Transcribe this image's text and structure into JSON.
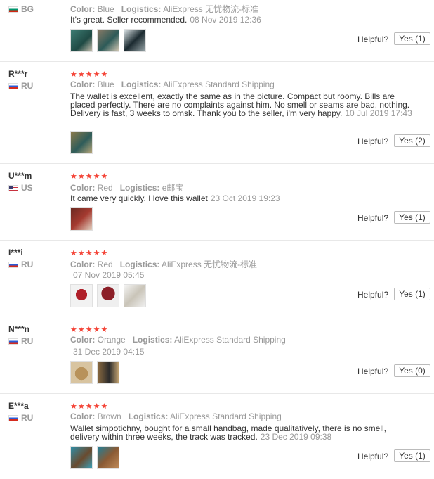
{
  "labels": {
    "color": "Color:",
    "logistics": "Logistics:",
    "helpful": "Helpful?"
  },
  "reviews": [
    {
      "user": "",
      "country": "BG",
      "flag": "bg",
      "stars": "",
      "color": "Blue",
      "logistics": "AliExpress 无忧物流-标准",
      "text": "It's great. Seller recommended.",
      "date": "08 Nov 2019 12:36",
      "images": [
        "wallet-photo",
        "wallet-photo",
        "wallet-photo"
      ],
      "helpful": "Yes (1)"
    },
    {
      "user": "R***r",
      "country": "RU",
      "flag": "ru",
      "stars": "★★★★★",
      "color": "Blue",
      "logistics": "AliExpress Standard Shipping",
      "text": "The wallet is excellent, exactly the same as in the picture. Compact but roomy. Bills are placed perfectly. There are no complaints against him. No smell or seams are bad, nothing. Delivery is fast, 3 weeks to omsk. Thank you to the seller, i'm very happy.",
      "date": "10 Jul 2019 17:43",
      "images": [
        "wallet-photo"
      ],
      "helpful": "Yes (2)"
    },
    {
      "user": "U***m",
      "country": "US",
      "flag": "us",
      "stars": "★★★★★",
      "color": "Red",
      "logistics": "e邮宝",
      "text": "It came very quickly. I love this wallet",
      "date": "23 Oct 2019 19:23",
      "images": [
        "wallet-photo"
      ],
      "helpful": "Yes (1)"
    },
    {
      "user": "I***i",
      "country": "RU",
      "flag": "ru",
      "stars": "★★★★★",
      "color": "Red",
      "logistics": "AliExpress 无忧物流-标准",
      "text": "",
      "date": "07 Nov 2019 05:45",
      "images": [
        "wallet-photo",
        "wallet-photo",
        "wallet-photo"
      ],
      "helpful": "Yes (1)"
    },
    {
      "user": "N***n",
      "country": "RU",
      "flag": "ru",
      "stars": "★★★★★",
      "color": "Orange",
      "logistics": "AliExpress Standard Shipping",
      "text": "",
      "date": "31 Dec 2019 04:15",
      "images": [
        "wallet-photo",
        "wallet-photo"
      ],
      "helpful": "Yes (0)"
    },
    {
      "user": "E***a",
      "country": "RU",
      "flag": "ru",
      "stars": "★★★★★",
      "color": "Brown",
      "logistics": "AliExpress Standard Shipping",
      "text": "Wallet simpotichny, bought for a small handbag, made qualitatively, there is no smell, delivery within three weeks, the track was tracked.",
      "date": "23 Dec 2019 09:38",
      "images": [
        "wallet-photo",
        "wallet-photo"
      ],
      "helpful": "Yes (1)"
    }
  ]
}
